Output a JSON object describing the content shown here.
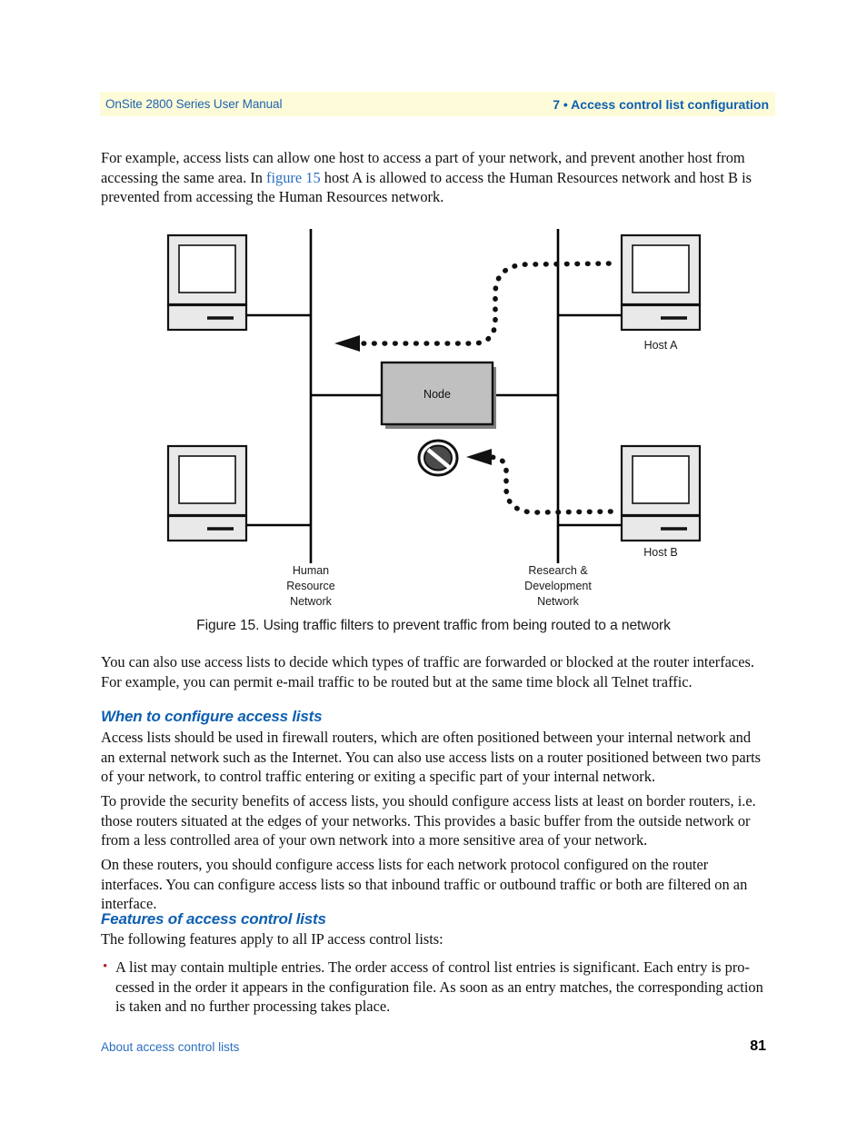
{
  "header": {
    "left_title": "OnSite 2800 Series User Manual",
    "right_title": "7 • Access control list configuration"
  },
  "intro": {
    "text_before_link": "For example, access lists can allow one host to access a part of your network, and prevent another host from accessing the same area. In ",
    "link_label": "figure 15",
    "text_after_link": " host A is allowed to access the Human Resources network and host B is prevented from accessing the Human Resources network."
  },
  "figure": {
    "caption": "Figure 15. Using traffic filters to prevent traffic from being routed to a network",
    "node_label": "Node",
    "host_a_label": "Host A",
    "host_b_label": "Host B",
    "left_network_label_line1": "Human",
    "left_network_label_line2": "Resource",
    "left_network_label_line3": "Network",
    "right_network_label_line1": "Research &",
    "right_network_label_line2": "Development",
    "right_network_label_line3": "Network",
    "colors": {
      "device_fill": "#e9e9e9",
      "screen_fill": "#ffffff",
      "node_fill": "#c0c0c0",
      "line": "#000000",
      "shadow": "#808080"
    }
  },
  "body": {
    "para_after_figure": "You can also use access lists to decide which types of traffic are forwarded or blocked at the router interfaces. For example, you can permit e-mail traffic to be routed but at the same time block all Telnet traffic.",
    "heading_when": "When to configure access lists",
    "para_when_1": "Access lists should be used in firewall routers, which are often positioned between your internal network and an external network such as the Internet. You can also use access lists on a router positioned between two parts of your network, to control traffic entering or exiting a specific part of your internal network.",
    "para_when_2": "To provide the security benefits of access lists, you should configure access lists at least on border routers, i.e. those routers situated at the edges of your networks. This provides a basic buffer from the outside network or from a less controlled area of your own network into a more sensitive area of your network.",
    "para_when_3": "On these routers, you should configure access lists for each network protocol configured on the router interfaces. You can configure access lists so that inbound traffic or outbound traffic or both are filtered on an interface.",
    "heading_features": "Features of access control lists",
    "para_features_intro": "The following features apply to all IP access control lists:",
    "bullet_mark": "•",
    "bullet_1": "A list may contain multiple entries. The order access of control list entries is significant. Each entry is pro-cessed in the order it appears in the configuration file. As soon as an entry matches, the corresponding action is taken and no further processing takes place."
  },
  "footer": {
    "left_label": "About access control lists",
    "page_number": "81"
  },
  "accent_colors": {
    "header_band": "#fdfbd8",
    "heading_blue": "#0e5fb0",
    "link_blue": "#2a6fc0",
    "bullet_red": "#b02020"
  }
}
